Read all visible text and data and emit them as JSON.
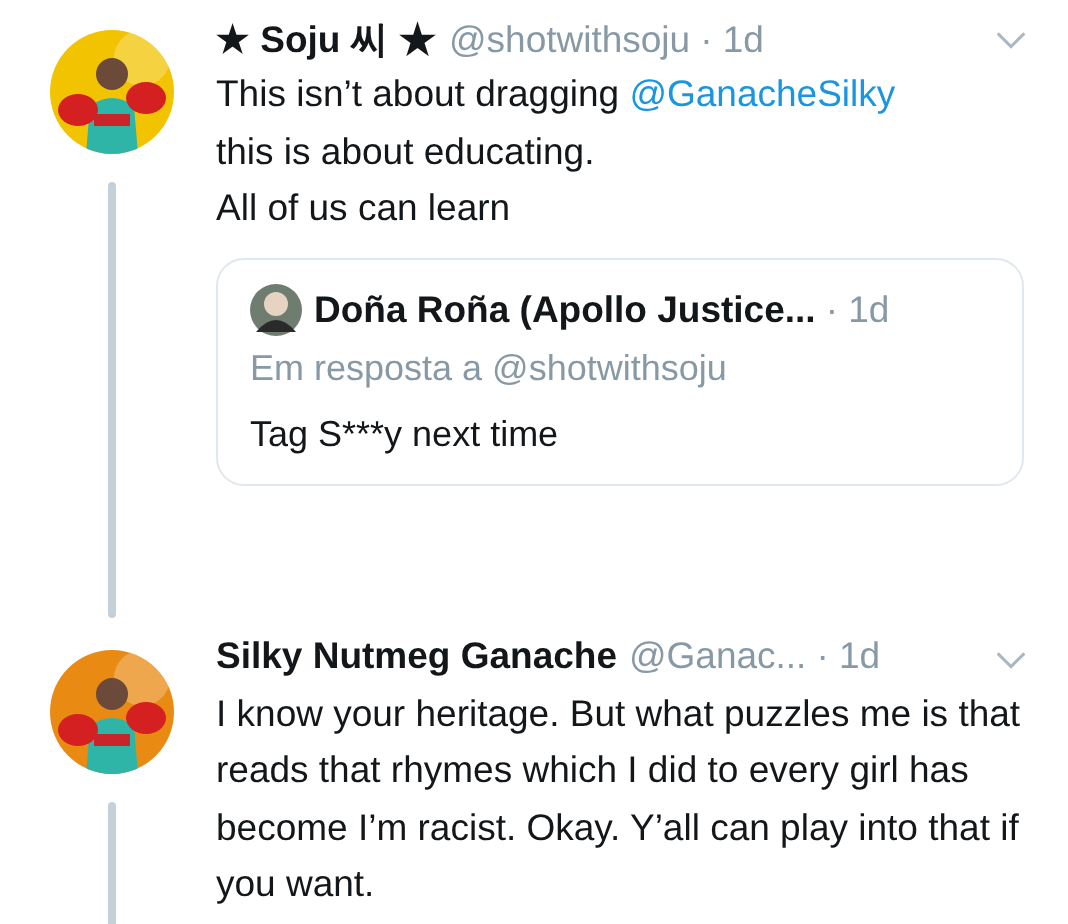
{
  "tweets": [
    {
      "name": "★ Soju 씨 ★",
      "handle": "@shotwithsoju",
      "time": "· 1d",
      "avatar": {
        "kind": "picture"
      },
      "thread_below": true,
      "body": [
        {
          "kind": "text",
          "text": "This isn’t about dragging "
        },
        {
          "kind": "mention",
          "text": "@GanacheSilky"
        },
        {
          "kind": "text",
          "text": "\nthis is about educating.\nAll of us can learn"
        }
      ],
      "quote": {
        "name": "Doña Roña (Apollo Justice...",
        "time": "· 1d",
        "reply_to": "Em resposta a @shotwithsoju",
        "text": "Tag S***y next time"
      }
    },
    {
      "name": "Silky Nutmeg Ganache",
      "handle": "@Ganac...",
      "time": "· 1d",
      "avatar": {
        "kind": "picture"
      },
      "thread_below": true,
      "body": [
        {
          "kind": "text",
          "text": "I know your heritage. But what puzzles me is that reads that rhymes which I did to every girl has become I’m racist. Okay. Y’all can play into that if you want."
        }
      ]
    }
  ]
}
